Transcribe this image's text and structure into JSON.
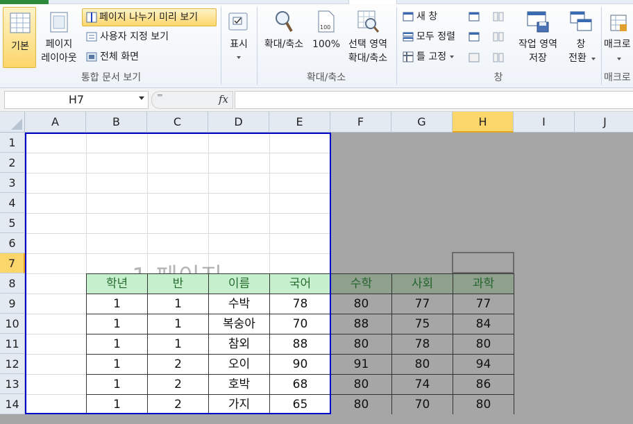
{
  "ribbon": {
    "basic_label": "기본",
    "page_layout_line1": "페이지",
    "page_layout_line2": "레이아웃",
    "page_break_preview": "페이지 나누기 미리 보기",
    "custom_view": "사용자 지정 보기",
    "full_screen": "전체 화면",
    "group_workbook_views": "통합 문서 보기",
    "show_label": "표시",
    "zoom_label": "확대/축소",
    "zoom_100": "100%",
    "zoom_selection_line1": "선택 영역",
    "zoom_selection_line2": "확대/축소",
    "group_zoom": "확대/축소",
    "new_window": "새 창",
    "arrange_all": "모두 정렬",
    "freeze_panes": "틀 고정",
    "save_workspace_line1": "작업 영역",
    "save_workspace_line2": "저장",
    "switch_windows_line1": "창",
    "switch_windows_line2": "전환",
    "group_window": "창",
    "macros_label": "매크로",
    "group_macros": "매크로"
  },
  "formula_bar": {
    "name_box": "H7",
    "fx": "fx",
    "formula": ""
  },
  "grid": {
    "columns": [
      "A",
      "B",
      "C",
      "D",
      "E",
      "F",
      "G",
      "H",
      "I",
      "J"
    ],
    "rows": [
      "1",
      "2",
      "3",
      "4",
      "5",
      "6",
      "7",
      "8",
      "9",
      "10",
      "11",
      "12",
      "13",
      "14"
    ],
    "selected_column": "H",
    "selected_row": "7",
    "watermark": "1 페이지"
  },
  "table": {
    "headers": [
      "학년",
      "반",
      "이름",
      "국어",
      "수학",
      "사회",
      "과학"
    ],
    "rows": [
      [
        "1",
        "1",
        "수박",
        "78",
        "80",
        "77",
        "77"
      ],
      [
        "1",
        "1",
        "복숭아",
        "70",
        "88",
        "75",
        "84"
      ],
      [
        "1",
        "1",
        "참외",
        "88",
        "80",
        "78",
        "80"
      ],
      [
        "1",
        "2",
        "오이",
        "90",
        "91",
        "80",
        "94"
      ],
      [
        "1",
        "2",
        "호박",
        "68",
        "80",
        "74",
        "86"
      ],
      [
        "1",
        "2",
        "가지",
        "65",
        "80",
        "70",
        "80"
      ]
    ]
  },
  "colors": {
    "page_border": "#0000c8",
    "header_fill": "#c6efce",
    "header_text": "#276b2e",
    "outside_area": "#a6a6a6",
    "selected_header": "#fbd66a"
  }
}
